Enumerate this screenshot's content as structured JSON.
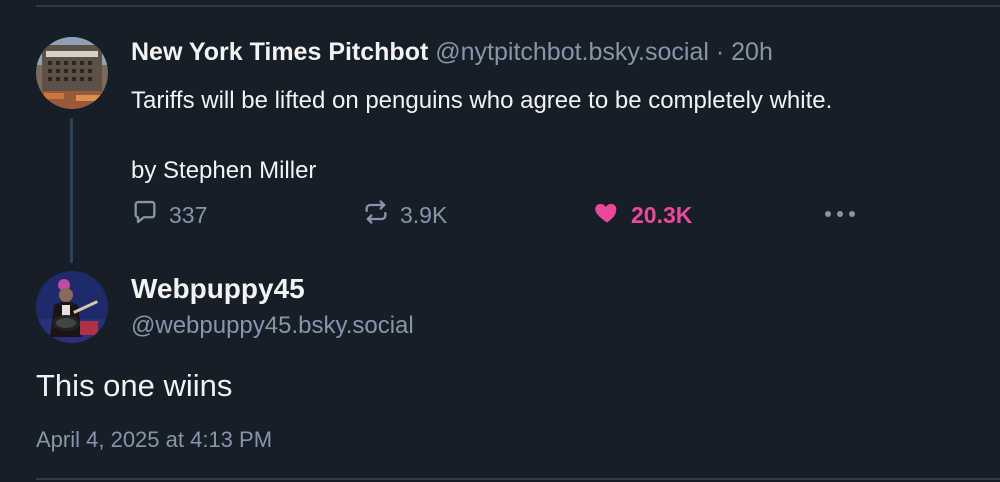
{
  "parent_post": {
    "author_name": "New York Times Pitchbot",
    "author_handle": "@nytpitchbot.bsky.social",
    "separator": "·",
    "time_ago": "20h",
    "text": "Tariffs will be lifted on penguins who agree to be completely white.\n\nby Stephen Miller",
    "stats": {
      "replies": "337",
      "reposts": "3.9K",
      "likes": "20.3K"
    },
    "like_color": "#ec4899",
    "icons": [
      "reply-icon",
      "repost-icon",
      "heart-icon",
      "more-options-icon"
    ]
  },
  "reply_post": {
    "author_name": "Webpuppy45",
    "author_handle": "@webpuppy45.bsky.social",
    "text": "This one wiins",
    "timestamp": "April 4, 2025 at 4:13 PM"
  },
  "colors": {
    "background": "#161e27",
    "text": "#f1f3f5",
    "muted": "#8796a6"
  }
}
